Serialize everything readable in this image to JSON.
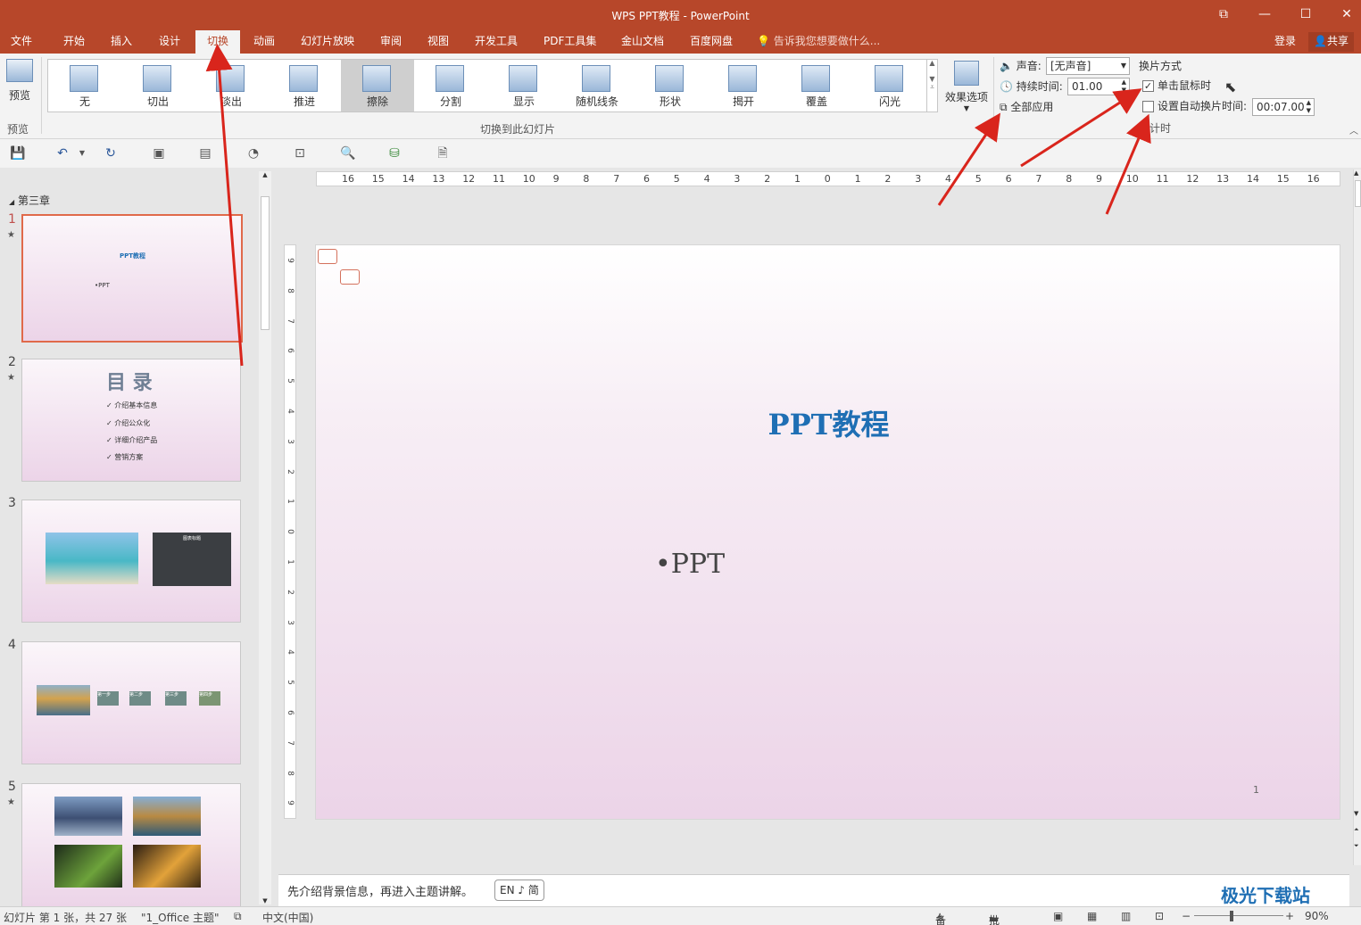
{
  "title": "WPS PPT教程 - PowerPoint",
  "tabs": [
    "文件",
    "开始",
    "插入",
    "设计",
    "切换",
    "动画",
    "幻灯片放映",
    "审阅",
    "视图",
    "开发工具",
    "PDF工具集",
    "金山文档",
    "百度网盘"
  ],
  "active_tab": "切换",
  "tell_me": "告诉我您想要做什么...",
  "login": "登录",
  "share": "共享",
  "ribbon": {
    "preview_label": "预览",
    "preview_group": "预览",
    "transitions": [
      "无",
      "切出",
      "淡出",
      "推进",
      "擦除",
      "分割",
      "显示",
      "随机线条",
      "形状",
      "揭开",
      "覆盖",
      "闪光"
    ],
    "selected_transition": "擦除",
    "group_label": "切换到此幻灯片",
    "effect_options": "效果选项",
    "sound_label": "声音:",
    "sound_value": "[无声音]",
    "duration_label": "持续时间:",
    "duration_value": "01.00",
    "apply_all": "全部应用",
    "advance_title": "换片方式",
    "on_click": "单击鼠标时",
    "on_click_checked": true,
    "auto_after": "设置自动换片时间:",
    "auto_after_checked": false,
    "auto_after_value": "00:07.00",
    "timing_group": "计时"
  },
  "panel": {
    "section": "第三章",
    "slides": [
      {
        "num": "1",
        "star": true,
        "title": "PPT教程",
        "body": "•PPT"
      },
      {
        "num": "2",
        "star": true,
        "title": "目 录",
        "items": [
          "✓ 介绍基本信息",
          "✓ 介绍公众化",
          "✓ 详细介绍产品",
          "✓ 营销方案"
        ]
      },
      {
        "num": "3",
        "star": false,
        "chart_title": "图表标题"
      },
      {
        "num": "4",
        "star": false,
        "steps": [
          "第一步",
          "第二步",
          "第三步",
          "第四步"
        ]
      },
      {
        "num": "5",
        "star": true
      }
    ]
  },
  "ruler": {
    "h_ticks": [
      "16",
      "15",
      "14",
      "13",
      "12",
      "11",
      "10",
      "9",
      "8",
      "7",
      "6",
      "5",
      "4",
      "3",
      "2",
      "1",
      "0",
      "1",
      "2",
      "3",
      "4",
      "5",
      "6",
      "7",
      "8",
      "9",
      "10",
      "11",
      "12",
      "13",
      "14",
      "15",
      "16"
    ],
    "v_ticks": [
      "9",
      "8",
      "7",
      "6",
      "5",
      "4",
      "3",
      "2",
      "1",
      "0",
      "1",
      "2",
      "3",
      "4",
      "5",
      "6",
      "7",
      "8",
      "9"
    ]
  },
  "slide": {
    "title": "PPT教程",
    "body": "•PPT",
    "number": "1"
  },
  "notes": {
    "text": "先介绍背景信息，再进入主题讲解。",
    "ime": "EN ♪ 简"
  },
  "status": {
    "slide_info": "幻灯片 第 1 张，共 27 张",
    "theme": "\"1_Office 主题\"",
    "language": "中文(中国)",
    "notes": "备注",
    "comments": "批注",
    "zoom": "90%"
  },
  "watermark": "极光下载站",
  "colors": {
    "accent": "#b7472a",
    "title_blue": "#1f6fb4",
    "annotation_red": "#d9251c"
  }
}
